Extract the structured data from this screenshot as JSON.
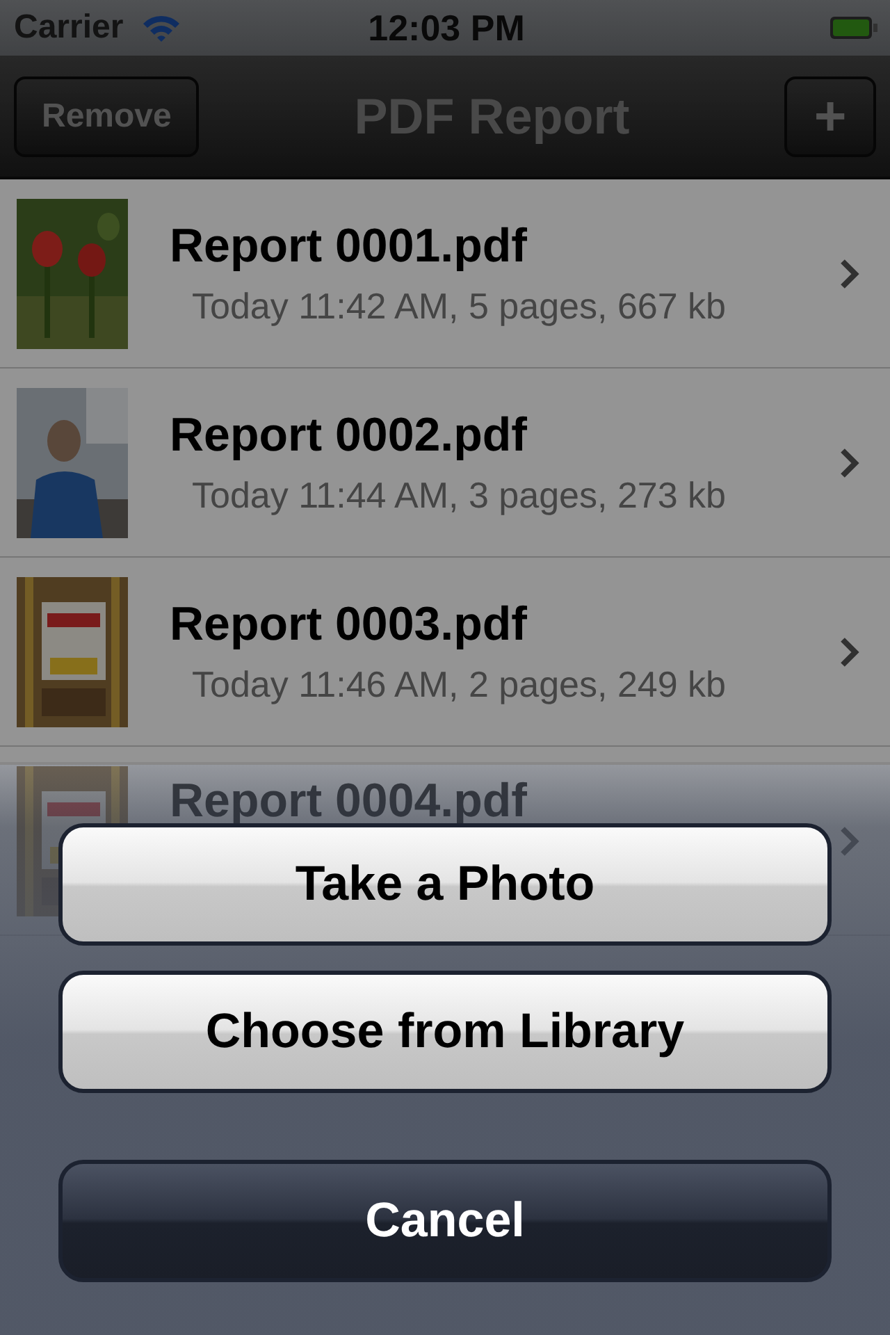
{
  "status_bar": {
    "carrier": "Carrier",
    "time": "12:03 PM"
  },
  "nav_bar": {
    "title": "PDF Report",
    "left_button": "Remove",
    "right_button": "+"
  },
  "reports": [
    {
      "title": "Report 0001.pdf",
      "details": "Today 11:42 AM, 5 pages, 667 kb"
    },
    {
      "title": "Report 0002.pdf",
      "details": "Today 11:44 AM, 3 pages, 273 kb"
    },
    {
      "title": "Report 0003.pdf",
      "details": "Today 11:46 AM, 2 pages, 249 kb"
    },
    {
      "title": "Report 0004.pdf"
    }
  ],
  "action_sheet": {
    "buttons": [
      {
        "label": "Take a Photo",
        "kind": "default"
      },
      {
        "label": "Choose from Library",
        "kind": "default"
      },
      {
        "label": "Cancel",
        "kind": "cancel"
      }
    ]
  }
}
